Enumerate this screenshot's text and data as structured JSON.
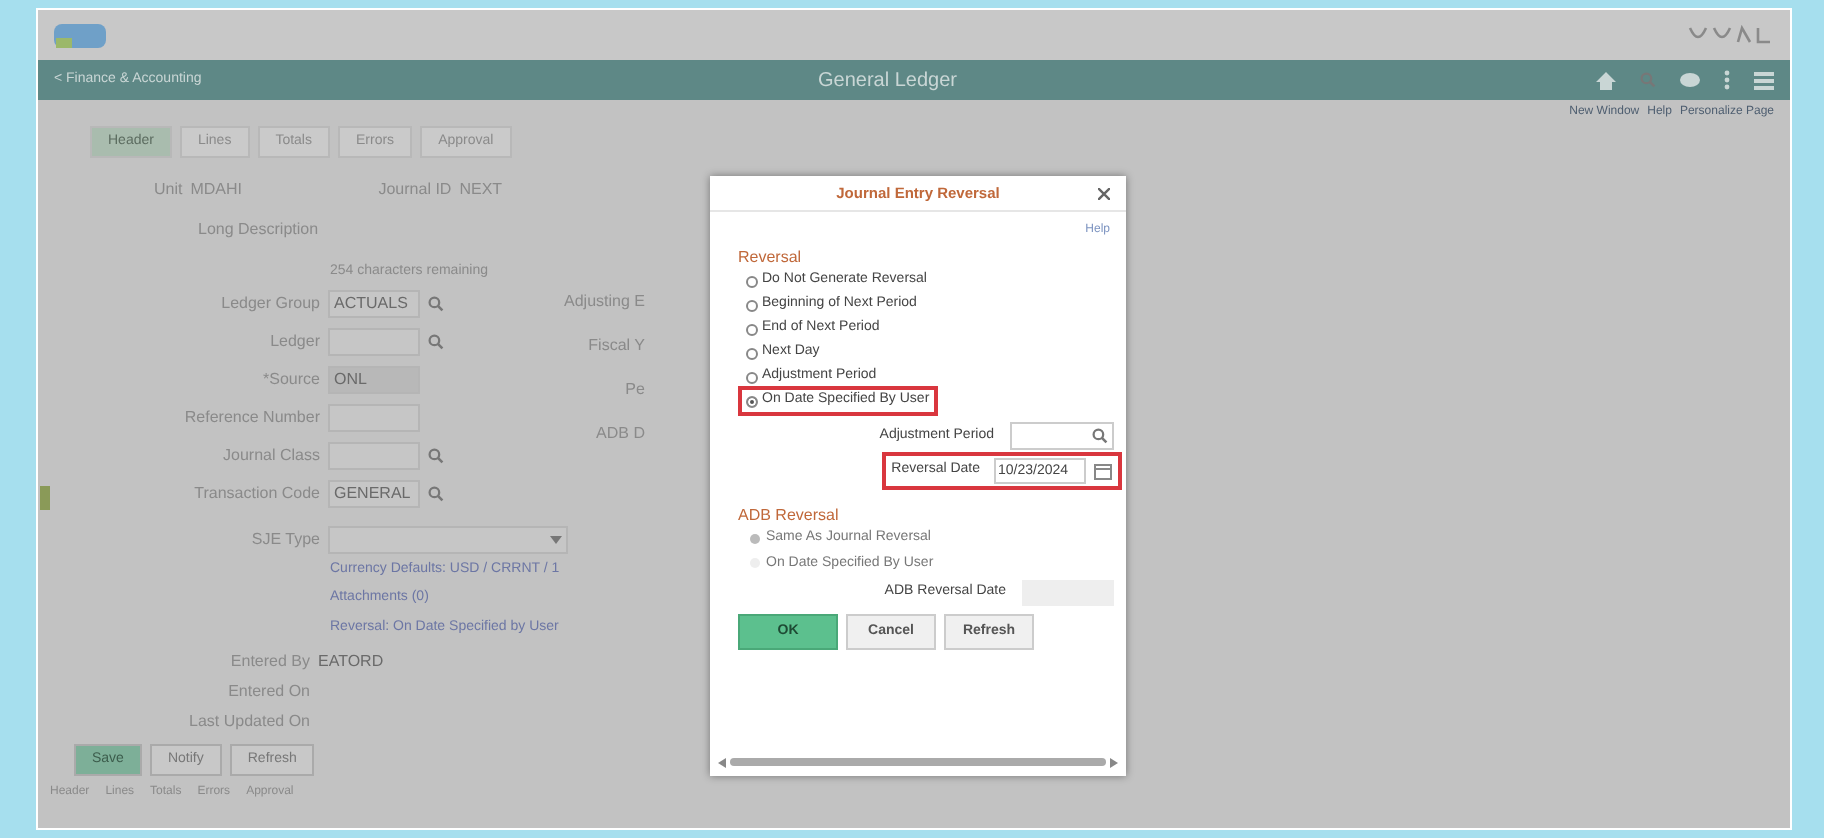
{
  "header": {
    "back_link": "< Finance & Accounting",
    "title": "General Ledger"
  },
  "breadcrumbs": [
    "New Window",
    "Help",
    "Personalize Page"
  ],
  "tabs": [
    {
      "label": "Header",
      "selected": true
    },
    {
      "label": "Lines",
      "selected": false
    },
    {
      "label": "Totals",
      "selected": false
    },
    {
      "label": "Errors",
      "selected": false
    },
    {
      "label": "Approval",
      "selected": false
    }
  ],
  "top_row": {
    "unit_label": "Unit",
    "unit_value": "MDAHI",
    "journal_label": "Journal ID",
    "journal_value": "NEXT",
    "long_description_label": "Long Description",
    "chars_remaining": "254 characters remaining"
  },
  "fields": [
    {
      "label": "Ledger Group",
      "value": "ACTUALS",
      "lookup": true,
      "disabled": false
    },
    {
      "label": "Ledger",
      "lookup": true,
      "disabled": false
    },
    {
      "label": "*Source",
      "value": "ONL",
      "lookup": false,
      "disabled": true
    },
    {
      "label": "Reference Number",
      "lookup": false,
      "disabled": false
    },
    {
      "label": "Journal Class",
      "lookup": true,
      "disabled": false
    },
    {
      "label": "Transaction Code",
      "value": "GENERAL",
      "lookup": true,
      "disabled": false
    }
  ],
  "right_labels": [
    "Adjusting E",
    "Fiscal Y",
    "Pe",
    "ADB D"
  ],
  "sje_type_label": "SJE Type",
  "links": [
    "Currency Defaults: USD / CRRNT / 1",
    "Attachments (0)",
    "Reversal: On Date Specified by User"
  ],
  "entered": [
    {
      "label": "Entered By",
      "value": "EATORD"
    },
    {
      "label": "Entered On"
    },
    {
      "label": "Last Updated On"
    }
  ],
  "page_buttons": [
    {
      "label": "Save",
      "primary": true
    },
    {
      "label": "Notify",
      "primary": false
    },
    {
      "label": "Refresh",
      "primary": false
    }
  ],
  "footer_links": [
    "Header",
    "Lines",
    "Totals",
    "Errors",
    "Approval"
  ],
  "dialog": {
    "title": "Journal Entry Reversal",
    "help": "Help",
    "reversal_heading": "Reversal",
    "options": [
      {
        "label": "Do Not Generate Reversal",
        "selected": false,
        "highlighted": false
      },
      {
        "label": "Beginning of Next Period",
        "selected": false,
        "highlighted": false
      },
      {
        "label": "End of Next Period",
        "selected": false,
        "highlighted": false
      },
      {
        "label": "Next Day",
        "selected": false,
        "highlighted": false
      },
      {
        "label": "Adjustment Period",
        "selected": false,
        "highlighted": false
      },
      {
        "label": "On Date Specified By User",
        "selected": true,
        "highlighted": true
      }
    ],
    "adjustment_period_label": "Adjustment Period",
    "reversal_date": {
      "label": "Reversal Date",
      "value": "10/23/2024",
      "highlighted": true
    },
    "adb_heading": "ADB Reversal",
    "adb_options": [
      {
        "label": "Same As Journal Reversal",
        "selected": true,
        "disabled": true
      },
      {
        "label": "On Date Specified By User",
        "selected": false,
        "disabled": true
      }
    ],
    "adb_date_label": "ADB Reversal Date",
    "buttons": [
      {
        "label": "OK",
        "primary": true
      },
      {
        "label": "Cancel",
        "primary": false
      },
      {
        "label": "Refresh",
        "primary": false
      }
    ]
  }
}
